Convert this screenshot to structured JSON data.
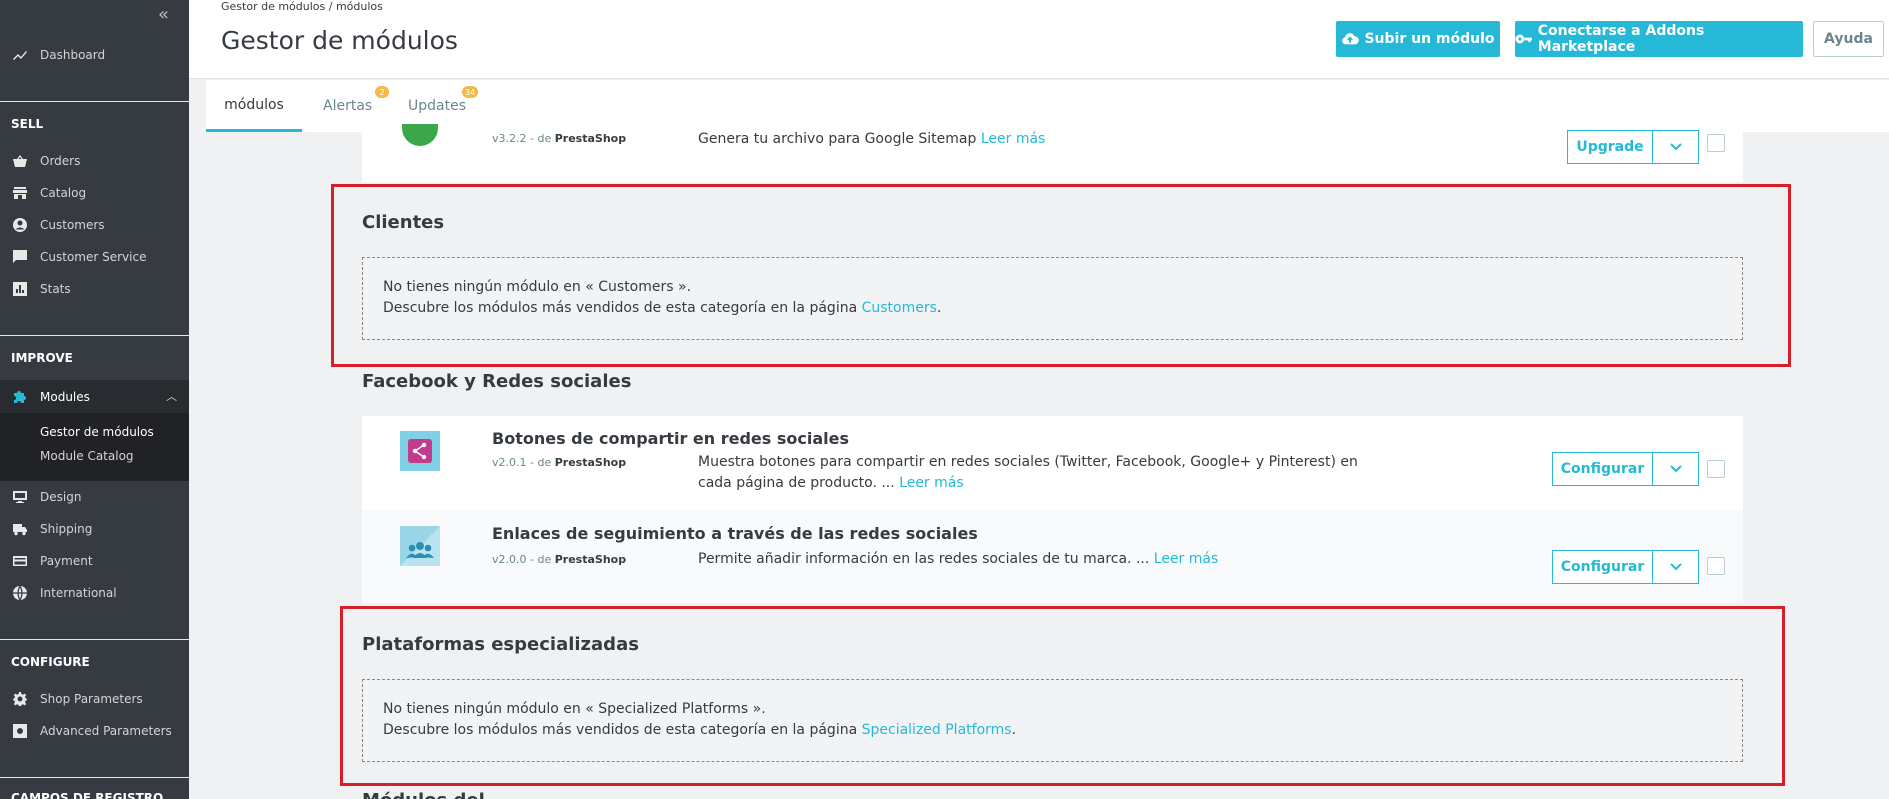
{
  "sidebar": {
    "collapse_glyph": "«",
    "dashboard": "Dashboard",
    "sections": {
      "sell": "SELL",
      "improve": "IMPROVE",
      "configure": "CONFIGURE",
      "more": "CAMPOS DE REGISTRO"
    },
    "sell_items": [
      "Orders",
      "Catalog",
      "Customers",
      "Customer Service",
      "Stats"
    ],
    "modules": "Modules",
    "modules_sub": [
      "Gestor de módulos",
      "Module Catalog"
    ],
    "improve_items": [
      "Design",
      "Shipping",
      "Payment",
      "International"
    ],
    "configure_items": [
      "Shop Parameters",
      "Advanced Parameters"
    ]
  },
  "header": {
    "breadcrumb": "Gestor de módulos  /  módulos",
    "title": "Gestor de módulos",
    "upload_btn": "Subir un módulo",
    "connect_btn": "Conectarse a Addons Marketplace",
    "help_btn": "Ayuda"
  },
  "tabs": [
    {
      "label": "módulos",
      "badge": ""
    },
    {
      "label": "Alertas",
      "badge": "2"
    },
    {
      "label": "Updates",
      "badge": "34"
    }
  ],
  "content": {
    "top_module": {
      "version": "v3.2.2 - de ",
      "author": "PrestaShop",
      "desc": "Genera tu archivo para Google Sitemap ",
      "more": "Leer más",
      "action": "Upgrade"
    },
    "clientes": {
      "title": "Clientes",
      "line1": "No tienes ningún módulo en « Customers ».",
      "line2": "Descubre los módulos más vendidos de esta categoría en la página ",
      "link": "Customers"
    },
    "facebook": {
      "title": "Facebook y Redes sociales",
      "modules": [
        {
          "name": "Botones de compartir en redes sociales",
          "version": "v2.0.1 - de ",
          "author": "PrestaShop",
          "desc": "Muestra botones para compartir en redes sociales (Twitter, Facebook, Google+ y Pinterest) en cada página de producto. ... ",
          "more": "Leer más",
          "action": "Configurar"
        },
        {
          "name": "Enlaces de seguimiento a través de las redes sociales",
          "version": "v2.0.0 - de ",
          "author": "PrestaShop",
          "desc": "Permite añadir información en las redes sociales de tu marca. ... ",
          "more": "Leer más",
          "action": "Configurar"
        }
      ]
    },
    "plataformas": {
      "title": "Plataformas especializadas",
      "line1": "No tienes ningún módulo en « Specialized Platforms ».",
      "line2": "Descubre los módulos más vendidos de esta categoría en la página ",
      "link": "Specialized Platforms"
    },
    "next_title": "Módulos del..."
  },
  "colors": {
    "accent": "#25b9d7",
    "highlight": "#d4202a",
    "sidebar": "#363a41",
    "badge": "#f4b94b"
  }
}
